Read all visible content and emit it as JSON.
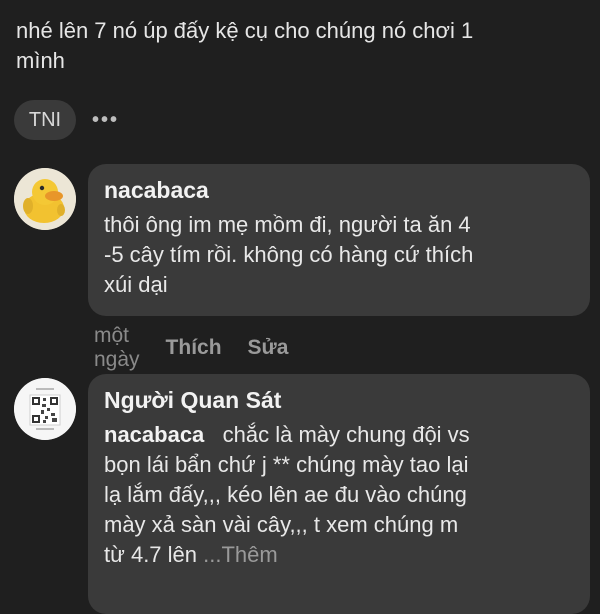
{
  "post": {
    "text_lines": [
      "nhé lên 7 nó úp đấy kệ cụ cho chúng nó chơi 1",
      "mình"
    ]
  },
  "reactor": {
    "initials": "TNI",
    "more_glyph": "•••"
  },
  "comments": [
    {
      "author": "nacabaca",
      "avatar_icon": "yellow-duck-icon",
      "text_lines": [
        "thôi ông im mẹ mồm đi, người ta ăn 4",
        "-5 cây tím rồi. không có hàng cứ thích",
        "xúi dại"
      ],
      "time": "một ngày",
      "like_label": "Thích",
      "edit_label": "Sửa"
    },
    {
      "author": "Người Quan Sát",
      "avatar_icon": "qr-code-icon",
      "mention": "nacabaca",
      "text_first": "chắc là mày chung đội vs",
      "text_lines": [
        "bọn lái bẩn chứ j ** chúng mày tao lại",
        "lạ lắm đấy,,, kéo lên ae đu vào chúng",
        "mày xả sàn vài cây,,, t xem chúng m"
      ],
      "text_last": "từ 4.7 lên",
      "more_label": "...Thêm"
    }
  ],
  "colors": {
    "background": "#1f1f1f",
    "bubble": "#3a3a3a",
    "duck": "#f2c230"
  }
}
